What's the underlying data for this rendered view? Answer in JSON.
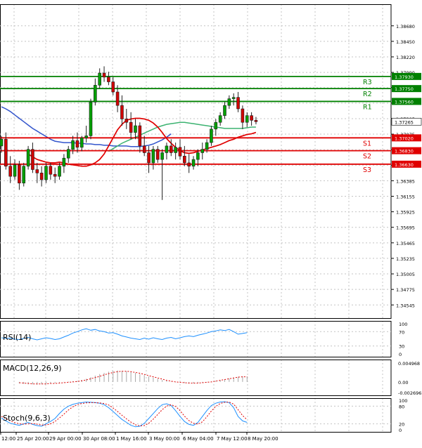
{
  "chart_data": [
    {
      "type": "candlestick",
      "panel": "price",
      "ylim": [
        1.3435,
        1.39
      ],
      "price_ticks": [
        1.3868,
        1.3845,
        1.3822,
        1.3799,
        1.37765,
        1.37535,
        1.37305,
        1.37075,
        1.36845,
        1.36615,
        1.36385,
        1.36155,
        1.35925,
        1.35695,
        1.35465,
        1.35235,
        1.35005,
        1.34775,
        1.34545
      ],
      "price_tick_labels": [
        "1.38680",
        "1.38450",
        "1.38220",
        "1.37990",
        "",
        "",
        "1.37305",
        "1.37075",
        "",
        "",
        "1.36385",
        "1.36155",
        "1.35925",
        "1.35695",
        "1.35465",
        "1.35235",
        "1.35005",
        "1.34775",
        "1.34545"
      ],
      "current_price": "1.37265",
      "levels": [
        {
          "name": "R3",
          "value": 1.3793,
          "label": "1.37930",
          "color": "#008000"
        },
        {
          "name": "R2",
          "value": 1.3775,
          "label": "1.37750",
          "color": "#008000"
        },
        {
          "name": "R1",
          "value": 1.3756,
          "label": "1.37560",
          "color": "#008000"
        },
        {
          "name": "S1",
          "value": 1.3702,
          "label": "1.37020",
          "color": "#e00000"
        },
        {
          "name": "S2",
          "value": 1.3683,
          "label": "1.36830",
          "color": "#e00000"
        },
        {
          "name": "S3",
          "value": 1.3663,
          "label": "1.36630",
          "color": "#e00000"
        }
      ],
      "candles": [
        [
          1.369,
          1.3705,
          1.368,
          1.37
        ],
        [
          1.37,
          1.371,
          1.3655,
          1.366
        ],
        [
          1.366,
          1.3675,
          1.3635,
          1.3645
        ],
        [
          1.3645,
          1.367,
          1.364,
          1.3662
        ],
        [
          1.3662,
          1.3668,
          1.3625,
          1.3635
        ],
        [
          1.3635,
          1.3665,
          1.363,
          1.366
        ],
        [
          1.366,
          1.369,
          1.3655,
          1.3685
        ],
        [
          1.3685,
          1.3695,
          1.365,
          1.3655
        ],
        [
          1.3655,
          1.3665,
          1.3635,
          1.365
        ],
        [
          1.365,
          1.366,
          1.363,
          1.364
        ],
        [
          1.364,
          1.3665,
          1.3635,
          1.366
        ],
        [
          1.366,
          1.3665,
          1.364,
          1.3648
        ],
        [
          1.3648,
          1.3658,
          1.3635,
          1.3645
        ],
        [
          1.3645,
          1.3665,
          1.364,
          1.366
        ],
        [
          1.366,
          1.3678,
          1.365,
          1.3672
        ],
        [
          1.3672,
          1.369,
          1.3665,
          1.3685
        ],
        [
          1.3685,
          1.3705,
          1.3678,
          1.3698
        ],
        [
          1.3698,
          1.371,
          1.368,
          1.3688
        ],
        [
          1.3688,
          1.3705,
          1.3682,
          1.3702
        ],
        [
          1.3702,
          1.372,
          1.3695,
          1.3705
        ],
        [
          1.3705,
          1.376,
          1.37,
          1.3755
        ],
        [
          1.3755,
          1.379,
          1.375,
          1.378
        ],
        [
          1.378,
          1.3805,
          1.3775,
          1.3798
        ],
        [
          1.3798,
          1.3808,
          1.3785,
          1.3792
        ],
        [
          1.3792,
          1.38,
          1.378,
          1.3785
        ],
        [
          1.3785,
          1.3792,
          1.3765,
          1.377
        ],
        [
          1.377,
          1.378,
          1.374,
          1.375
        ],
        [
          1.375,
          1.3765,
          1.372,
          1.373
        ],
        [
          1.373,
          1.3745,
          1.3715,
          1.3725
        ],
        [
          1.3725,
          1.374,
          1.37,
          1.371
        ],
        [
          1.371,
          1.373,
          1.37,
          1.372
        ],
        [
          1.372,
          1.3725,
          1.368,
          1.369
        ],
        [
          1.369,
          1.3705,
          1.3675,
          1.368
        ],
        [
          1.368,
          1.369,
          1.365,
          1.3665
        ],
        [
          1.3665,
          1.369,
          1.3655,
          1.3685
        ],
        [
          1.3685,
          1.369,
          1.3665,
          1.367
        ],
        [
          1.367,
          1.3685,
          1.361,
          1.368
        ],
        [
          1.368,
          1.3695,
          1.367,
          1.369
        ],
        [
          1.369,
          1.37,
          1.3675,
          1.368
        ],
        [
          1.368,
          1.3695,
          1.367,
          1.3688
        ],
        [
          1.3688,
          1.37,
          1.367,
          1.3675
        ],
        [
          1.3675,
          1.369,
          1.366,
          1.3665
        ],
        [
          1.3665,
          1.3678,
          1.365,
          1.366
        ],
        [
          1.366,
          1.3675,
          1.3655,
          1.367
        ],
        [
          1.367,
          1.3685,
          1.366,
          1.368
        ],
        [
          1.368,
          1.3695,
          1.367,
          1.3685
        ],
        [
          1.3685,
          1.37,
          1.368,
          1.3695
        ],
        [
          1.3695,
          1.372,
          1.369,
          1.3715
        ],
        [
          1.3715,
          1.373,
          1.3705,
          1.3725
        ],
        [
          1.3725,
          1.374,
          1.372,
          1.3735
        ],
        [
          1.3735,
          1.3755,
          1.373,
          1.375
        ],
        [
          1.375,
          1.3765,
          1.3745,
          1.376
        ],
        [
          1.376,
          1.3768,
          1.375,
          1.3762
        ],
        [
          1.3762,
          1.377,
          1.374,
          1.3745
        ],
        [
          1.3745,
          1.375,
          1.3715,
          1.3725
        ],
        [
          1.3725,
          1.374,
          1.3718,
          1.3735
        ],
        [
          1.3735,
          1.374,
          1.372,
          1.3728
        ],
        [
          1.3728,
          1.3733,
          1.3722,
          1.3726
        ]
      ],
      "ma_red": [
        1.3678,
        1.3674,
        1.367,
        1.3668,
        1.3666,
        1.3665,
        1.3665,
        1.3666,
        1.3665,
        1.3663,
        1.3662,
        1.3661,
        1.366,
        1.366,
        1.3662,
        1.3665,
        1.367,
        1.3678,
        1.369,
        1.3702,
        1.3714,
        1.3722,
        1.3728,
        1.373,
        1.3731,
        1.3731,
        1.373,
        1.3728,
        1.3724,
        1.3718,
        1.371,
        1.3701,
        1.3694,
        1.3688,
        1.3683,
        1.368,
        1.3679,
        1.368,
        1.3682,
        1.3684,
        1.3686,
        1.3688,
        1.369,
        1.3692,
        1.3695,
        1.3698,
        1.37,
        1.3703,
        1.3705,
        1.3707,
        1.3708,
        1.371
      ],
      "ma_green": [
        1.3682,
        1.3686,
        1.369,
        1.3694,
        1.3697,
        1.37,
        1.3703,
        1.3706,
        1.3709,
        1.3712,
        1.3715,
        1.3718,
        1.372,
        1.3722,
        1.3723,
        1.3724,
        1.3725,
        1.3725,
        1.3724,
        1.3723,
        1.3722,
        1.3721,
        1.372,
        1.3719,
        1.3718,
        1.3717,
        1.3716,
        1.3716,
        1.3716,
        1.3716,
        1.3716,
        1.3717,
        1.3718,
        1.3718
      ],
      "ma_blue": [
        1.3748,
        1.3745,
        1.3741,
        1.3736,
        1.3731,
        1.3726,
        1.3721,
        1.3716,
        1.3712,
        1.3708,
        1.3704,
        1.37,
        1.3697,
        1.3696,
        1.3695,
        1.3695,
        1.3695,
        1.3694,
        1.3694,
        1.3693,
        1.3693,
        1.3692,
        1.3692,
        1.3691,
        1.3691,
        1.369,
        1.369,
        1.369,
        1.369,
        1.3689,
        1.3689,
        1.3689,
        1.369,
        1.3691,
        1.3693,
        1.3696,
        1.3699,
        1.3703,
        1.3708
      ],
      "colors": {
        "bull": "#00a000",
        "bear": "#d00000",
        "blue": "#3355cc",
        "green": "#3cb371",
        "red": "#e00000"
      }
    },
    {
      "type": "line",
      "panel": "rsi",
      "title": "RSI(14)",
      "ylim": [
        0,
        100
      ],
      "ticks": [
        100,
        70,
        30,
        0
      ],
      "tick_labels": [
        "100",
        "70",
        "30",
        "0"
      ],
      "values": [
        53,
        51,
        52,
        49,
        48,
        51,
        54,
        50,
        47,
        50,
        53,
        51,
        48,
        50,
        55,
        60,
        66,
        70,
        75,
        78,
        74,
        76,
        72,
        70,
        66,
        67,
        63,
        58,
        55,
        52,
        50,
        48,
        52,
        49,
        53,
        50,
        48,
        52,
        54,
        50,
        53,
        56,
        58,
        56,
        60,
        63,
        66,
        70,
        72,
        75,
        73,
        76,
        70,
        63,
        65,
        67
      ],
      "color": "#1e90ff"
    },
    {
      "type": "bar",
      "panel": "macd",
      "title": "MACD(12,26,9)",
      "ylim": [
        -0.002696,
        0.004968
      ],
      "ticks": [
        0.004968,
        0.0,
        -0.002696
      ],
      "tick_labels": [
        "0.004968",
        "0.00",
        "-0.002696"
      ],
      "histogram": [
        -0.0004,
        -0.0005,
        -0.0006,
        -0.0006,
        -0.0007,
        -0.0006,
        -0.0005,
        -0.0004,
        -0.0003,
        -0.0002,
        -0.0001,
        0.0001,
        0.0002,
        0.0003,
        0.0005,
        0.0008,
        0.0012,
        0.0016,
        0.002,
        0.0023,
        0.0026,
        0.0028,
        0.0029,
        0.0028,
        0.0027,
        0.0025,
        0.0023,
        0.002,
        0.0017,
        0.0014,
        0.0011,
        0.0008,
        0.0005,
        0.0003,
        0.0001,
        -0.0001,
        -0.0002,
        -0.0003,
        -0.0004,
        -0.0004,
        -0.0003,
        -0.0002,
        -0.0001,
        0.0001,
        0.0003,
        0.0005,
        0.0007,
        0.0009,
        0.0011,
        0.0013,
        0.0014,
        0.0014
      ],
      "signal": [
        -0.0002,
        -0.0003,
        -0.0004,
        -0.0005,
        -0.0005,
        -0.0005,
        -0.0005,
        -0.0004,
        -0.0004,
        -0.0003,
        -0.0002,
        -0.0001,
        0.0,
        0.0001,
        0.0003,
        0.0005,
        0.0008,
        0.0011,
        0.0014,
        0.0018,
        0.0021,
        0.0024,
        0.0026,
        0.0027,
        0.0027,
        0.0026,
        0.0024,
        0.0022,
        0.0019,
        0.0016,
        0.0013,
        0.001,
        0.0007,
        0.0004,
        0.0002,
        0.0,
        -0.0001,
        -0.0002,
        -0.0003,
        -0.0003,
        -0.0003,
        -0.0002,
        -0.0001,
        0.0,
        0.0002,
        0.0004,
        0.0006,
        0.0008,
        0.001,
        0.0012,
        0.0013,
        0.0013
      ],
      "colors": {
        "hist": "#a8a8a8",
        "signal": "#e00000"
      }
    },
    {
      "type": "line",
      "panel": "stoch",
      "title": "Stoch(9,6,3)",
      "ylim": [
        0,
        100
      ],
      "ticks": [
        100,
        80,
        20,
        0
      ],
      "tick_labels": [
        "100",
        "80",
        "20",
        "0"
      ],
      "main": [
        40,
        30,
        22,
        18,
        15,
        20,
        25,
        18,
        14,
        12,
        20,
        28,
        38,
        55,
        70,
        80,
        86,
        90,
        92,
        94,
        93,
        92,
        90,
        85,
        75,
        62,
        48,
        35,
        25,
        15,
        10,
        12,
        22,
        38,
        55,
        72,
        85,
        88,
        82,
        65,
        45,
        28,
        18,
        15,
        25,
        45,
        65,
        82,
        90,
        94,
        95,
        92,
        75,
        45,
        30,
        25
      ],
      "signal": [
        45,
        38,
        30,
        24,
        20,
        19,
        20,
        21,
        19,
        16,
        16,
        20,
        28,
        40,
        53,
        67,
        78,
        85,
        89,
        91,
        92,
        92,
        91,
        89,
        84,
        74,
        62,
        49,
        37,
        26,
        17,
        13,
        14,
        22,
        36,
        52,
        68,
        80,
        85,
        79,
        65,
        46,
        31,
        22,
        19,
        27,
        44,
        63,
        79,
        89,
        93,
        94,
        87,
        68,
        48,
        34
      ],
      "colors": {
        "main": "#1e90ff",
        "signal": "#e00000"
      }
    }
  ],
  "time_labels": [
    "12:00",
    "25 Apr 20:00",
    "29 Apr 00:00",
    "30 Apr 08:00",
    "1 May 16:00",
    "3 May 00:00",
    "6 May 04:00",
    "7 May 12:00",
    "8 May 20:00"
  ]
}
